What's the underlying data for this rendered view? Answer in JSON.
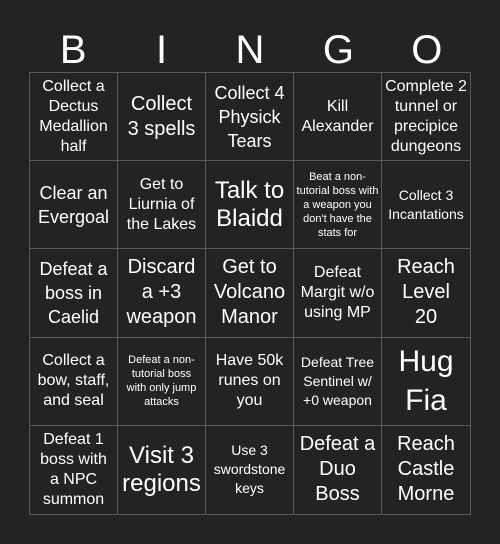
{
  "header": {
    "letters": [
      "B",
      "I",
      "N",
      "G",
      "O"
    ]
  },
  "board": {
    "cells": [
      "Collect a Dectus Medallion half",
      "Collect 3 spells",
      "Collect 4 Physick Tears",
      "Kill Alexander",
      "Complete 2 tunnel or precipice dungeons",
      "Clear an Evergoal",
      "Get to Liurnia of the Lakes",
      "Talk to Blaidd",
      "Beat a non-tutorial boss with a weapon you don't have the stats for",
      "Collect 3 Incantations",
      "Defeat a boss in Caelid",
      "Discard a +3 weapon",
      "Get to Volcano Manor",
      "Defeat Margit w/o using MP",
      "Reach Level 20",
      "Collect a bow, staff, and seal",
      "Defeat a non-tutorial boss with only jump attacks",
      "Have 50k runes on you",
      "Defeat Tree Sentinel w/ +0 weapon",
      "Hug Fia",
      "Defeat 1 boss with a NPC summon",
      "Visit 3 regions",
      "Use 3 swordstone keys",
      "Defeat a Duo Boss",
      "Reach Castle Morne"
    ]
  },
  "colors": {
    "background": "#232323",
    "grid_line": "#5a5a5a",
    "text": "#ffffff"
  }
}
